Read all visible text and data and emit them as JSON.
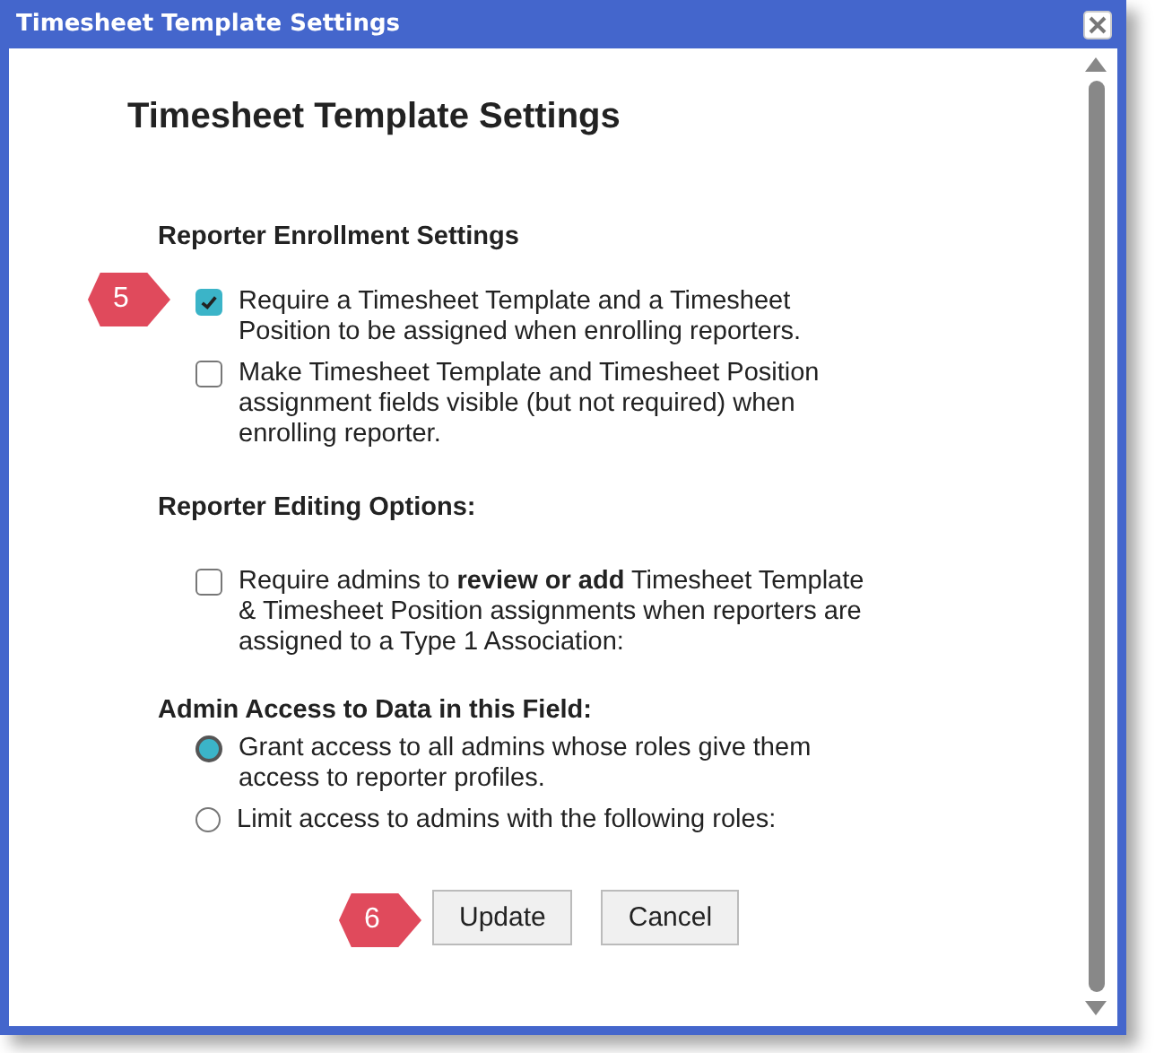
{
  "window": {
    "title": "Timesheet Template Settings"
  },
  "heading": "Timesheet Template Settings",
  "sections": [
    {
      "title": "Reporter Enrollment Settings",
      "options": [
        {
          "kind": "checkbox",
          "label": "Require a Timesheet Template and a Timesheet Position to be assigned when enrolling reporters.",
          "checked": true,
          "callout": "5"
        },
        {
          "kind": "checkbox",
          "label": "Make Timesheet Template and Timesheet Position assignment fields visible (but not required) when enrolling reporter.",
          "checked": false
        }
      ]
    },
    {
      "title": "Reporter Editing Options:",
      "options": [
        {
          "kind": "checkbox",
          "label": "Require admins to **review or add** Timesheet Template & Timesheet Position assignments when reporters are assigned to a Type 1 Association:",
          "checked": false
        }
      ]
    },
    {
      "title": "Admin Access to Data in this Field:",
      "options": [
        {
          "kind": "radio",
          "label": "Grant access to all admins whose roles give them access to reporter profiles.",
          "selected": true
        },
        {
          "kind": "radio",
          "label": "Limit access to admins with the following roles:",
          "selected": false
        }
      ]
    }
  ],
  "buttons": [
    {
      "label": "Update",
      "callout": "6"
    },
    {
      "label": "Cancel"
    }
  ]
}
